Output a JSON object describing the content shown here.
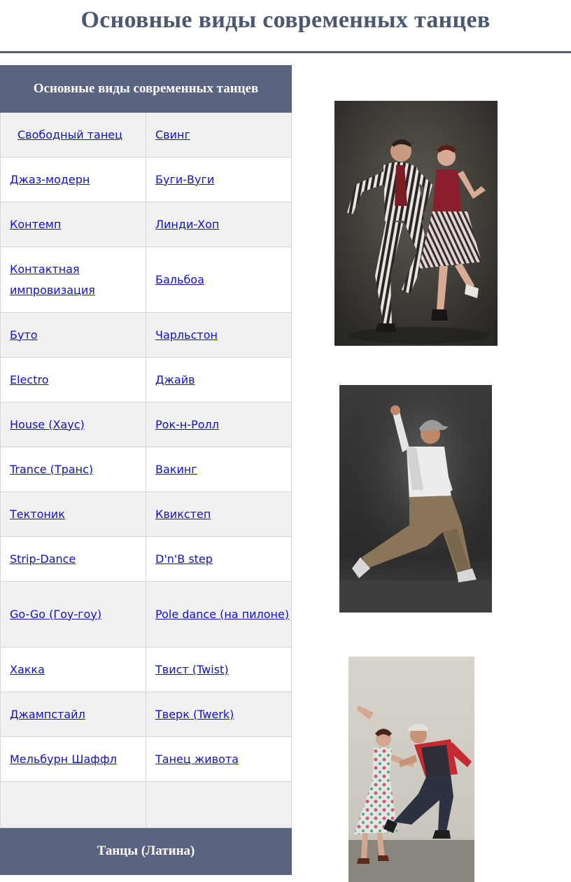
{
  "page": {
    "title": "Основные виды современных танцев"
  },
  "table": {
    "header": "Основные виды современных танцев",
    "rows": [
      [
        "Свободный танец",
        "Свинг"
      ],
      [
        "Джаз-модерн",
        "Буги-Вуги"
      ],
      [
        "Контемп",
        "Линди-Хоп"
      ],
      [
        "Контактная импровизация",
        "Бальбоа"
      ],
      [
        "Буто",
        "Чарльстон"
      ],
      [
        "Electro",
        "Джайв"
      ],
      [
        "House (Хаус)",
        "Рок-н-Ролл"
      ],
      [
        "Trance (Транс)",
        "Вакинг"
      ],
      [
        "Тектоник",
        "Квикстеп"
      ],
      [
        "Strip-Dance",
        "D'n'B step"
      ],
      [
        "Go-Go (Гоу-гоу)",
        "Pole dance (на пилоне)"
      ],
      [
        "Хакка",
        "Твист (Twist)"
      ],
      [
        "Джампстайл",
        "Тверк (Twerk)"
      ],
      [
        "Мельбурн Шаффл",
        "Танец живота"
      ],
      [
        "",
        ""
      ]
    ],
    "footer": "Танцы (Латина)"
  },
  "colors": {
    "title": "#4a5870",
    "table_header_bg": "#5a637f",
    "link": "#1010cc",
    "row_alt_bg": "#f1f1f1"
  },
  "images": [
    {
      "name": "swing-dancers-photo"
    },
    {
      "name": "hip-hop-dancer-photo"
    },
    {
      "name": "lindy-hop-couple-photo"
    }
  ]
}
